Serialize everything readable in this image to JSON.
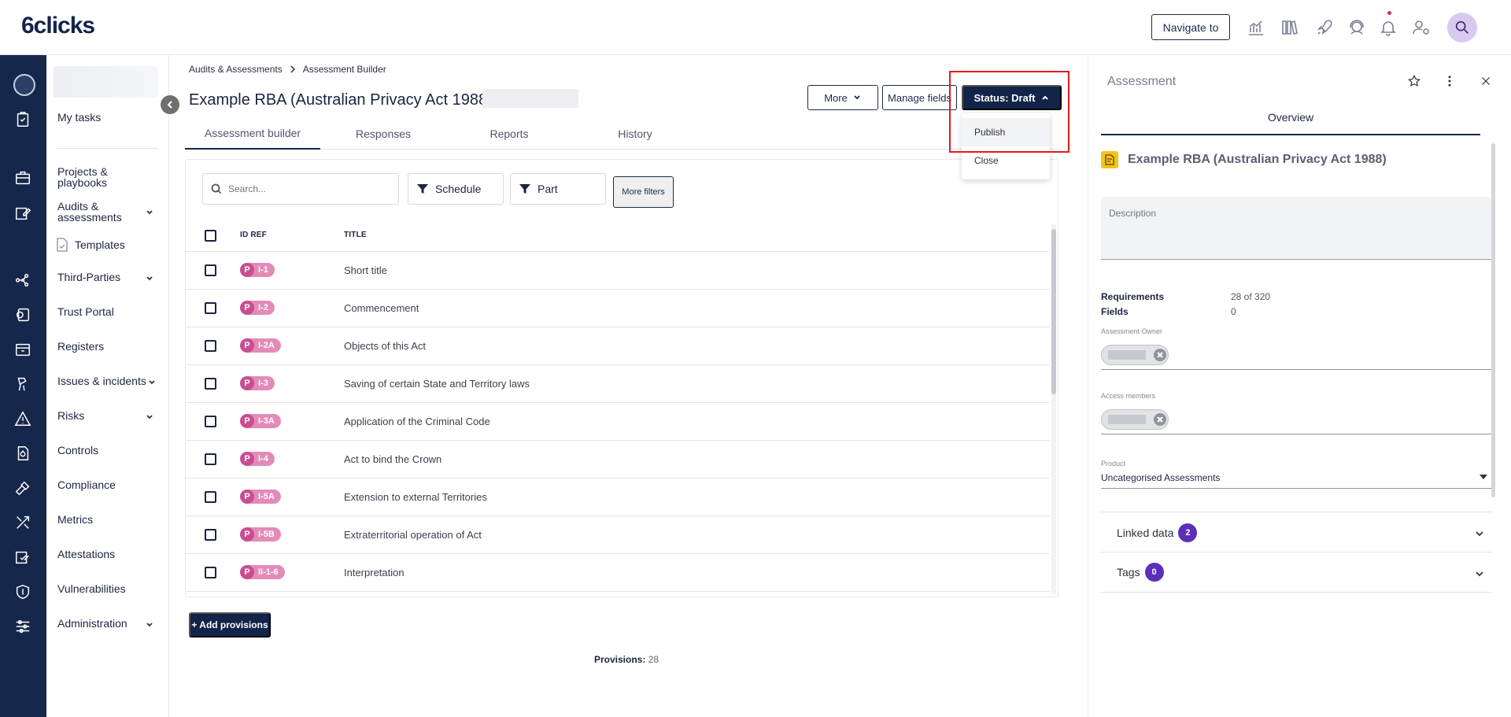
{
  "brand": {
    "logo_text": "6clicks"
  },
  "header": {
    "navigate_label": "Navigate to",
    "icons": [
      "analytics-icon",
      "library-icon",
      "rocket-icon",
      "support-icon",
      "bell-icon",
      "user-settings-icon",
      "search-user-icon"
    ]
  },
  "sidebar": {
    "my_tasks": "My tasks",
    "items": [
      {
        "label": "Projects & playbooks"
      },
      {
        "label": "Audits & assessments"
      },
      {
        "label": "Templates"
      },
      {
        "label": "Third-Parties"
      },
      {
        "label": "Trust Portal"
      },
      {
        "label": "Registers"
      },
      {
        "label": "Issues & incidents"
      },
      {
        "label": "Risks"
      },
      {
        "label": "Controls"
      },
      {
        "label": "Compliance"
      },
      {
        "label": "Metrics"
      },
      {
        "label": "Attestations"
      },
      {
        "label": "Vulnerabilities"
      },
      {
        "label": "Administration"
      }
    ]
  },
  "breadcrumb": {
    "parent": "Audits & Assessments",
    "current": "Assessment Builder"
  },
  "page": {
    "title": "Example RBA (Australian Privacy Act 1988)",
    "more_label": "More",
    "manage_fields_label": "Manage fields",
    "status_label": "Status: Draft",
    "status_menu": [
      "Publish",
      "Close"
    ]
  },
  "tabs": [
    "Assessment builder",
    "Responses",
    "Reports",
    "History"
  ],
  "filters": {
    "search_placeholder": "Search...",
    "schedule_label": "Schedule",
    "part_label": "Part",
    "more_filters_label": "More filters"
  },
  "table": {
    "headers": {
      "id_ref": "ID REF",
      "title": "TITLE"
    },
    "rows": [
      {
        "badge": "P",
        "ref": "I-1",
        "title": "Short title"
      },
      {
        "badge": "P",
        "ref": "I-2",
        "title": "Commencement"
      },
      {
        "badge": "P",
        "ref": "I-2A",
        "title": "Objects of this Act"
      },
      {
        "badge": "P",
        "ref": "I-3",
        "title": "Saving of certain State and Territory laws"
      },
      {
        "badge": "P",
        "ref": "I-3A",
        "title": "Application of the Criminal Code"
      },
      {
        "badge": "P",
        "ref": "I-4",
        "title": "Act to bind the Crown"
      },
      {
        "badge": "P",
        "ref": "I-5A",
        "title": "Extension to external Territories"
      },
      {
        "badge": "P",
        "ref": "I-5B",
        "title": "Extraterritorial operation of Act"
      },
      {
        "badge": "P",
        "ref": "II-1-6",
        "title": "Interpretation"
      }
    ]
  },
  "footer": {
    "add_label": "+ Add provisions",
    "provisions_label": "Provisions:",
    "provisions_count": "28"
  },
  "panel": {
    "header": "Assessment",
    "tab": "Overview",
    "title": "Example RBA (Australian Privacy Act 1988)",
    "description_placeholder": "Description",
    "requirements_label": "Requirements",
    "requirements_value": "28 of 320",
    "fields_label": "Fields",
    "fields_value": "0",
    "owner_label": "Assessment Owner",
    "members_label": "Access members",
    "product_label": "Product",
    "product_value": "Uncategorised Assessments",
    "linked_data_label": "Linked data",
    "linked_data_count": "2",
    "tags_label": "Tags",
    "tags_count": "0"
  },
  "colors": {
    "navy": "#13244a",
    "pill": "#e38bb8",
    "pill_dark": "#c94d91",
    "badge": "#5b2fb8",
    "highlight": "#e11c1c"
  }
}
